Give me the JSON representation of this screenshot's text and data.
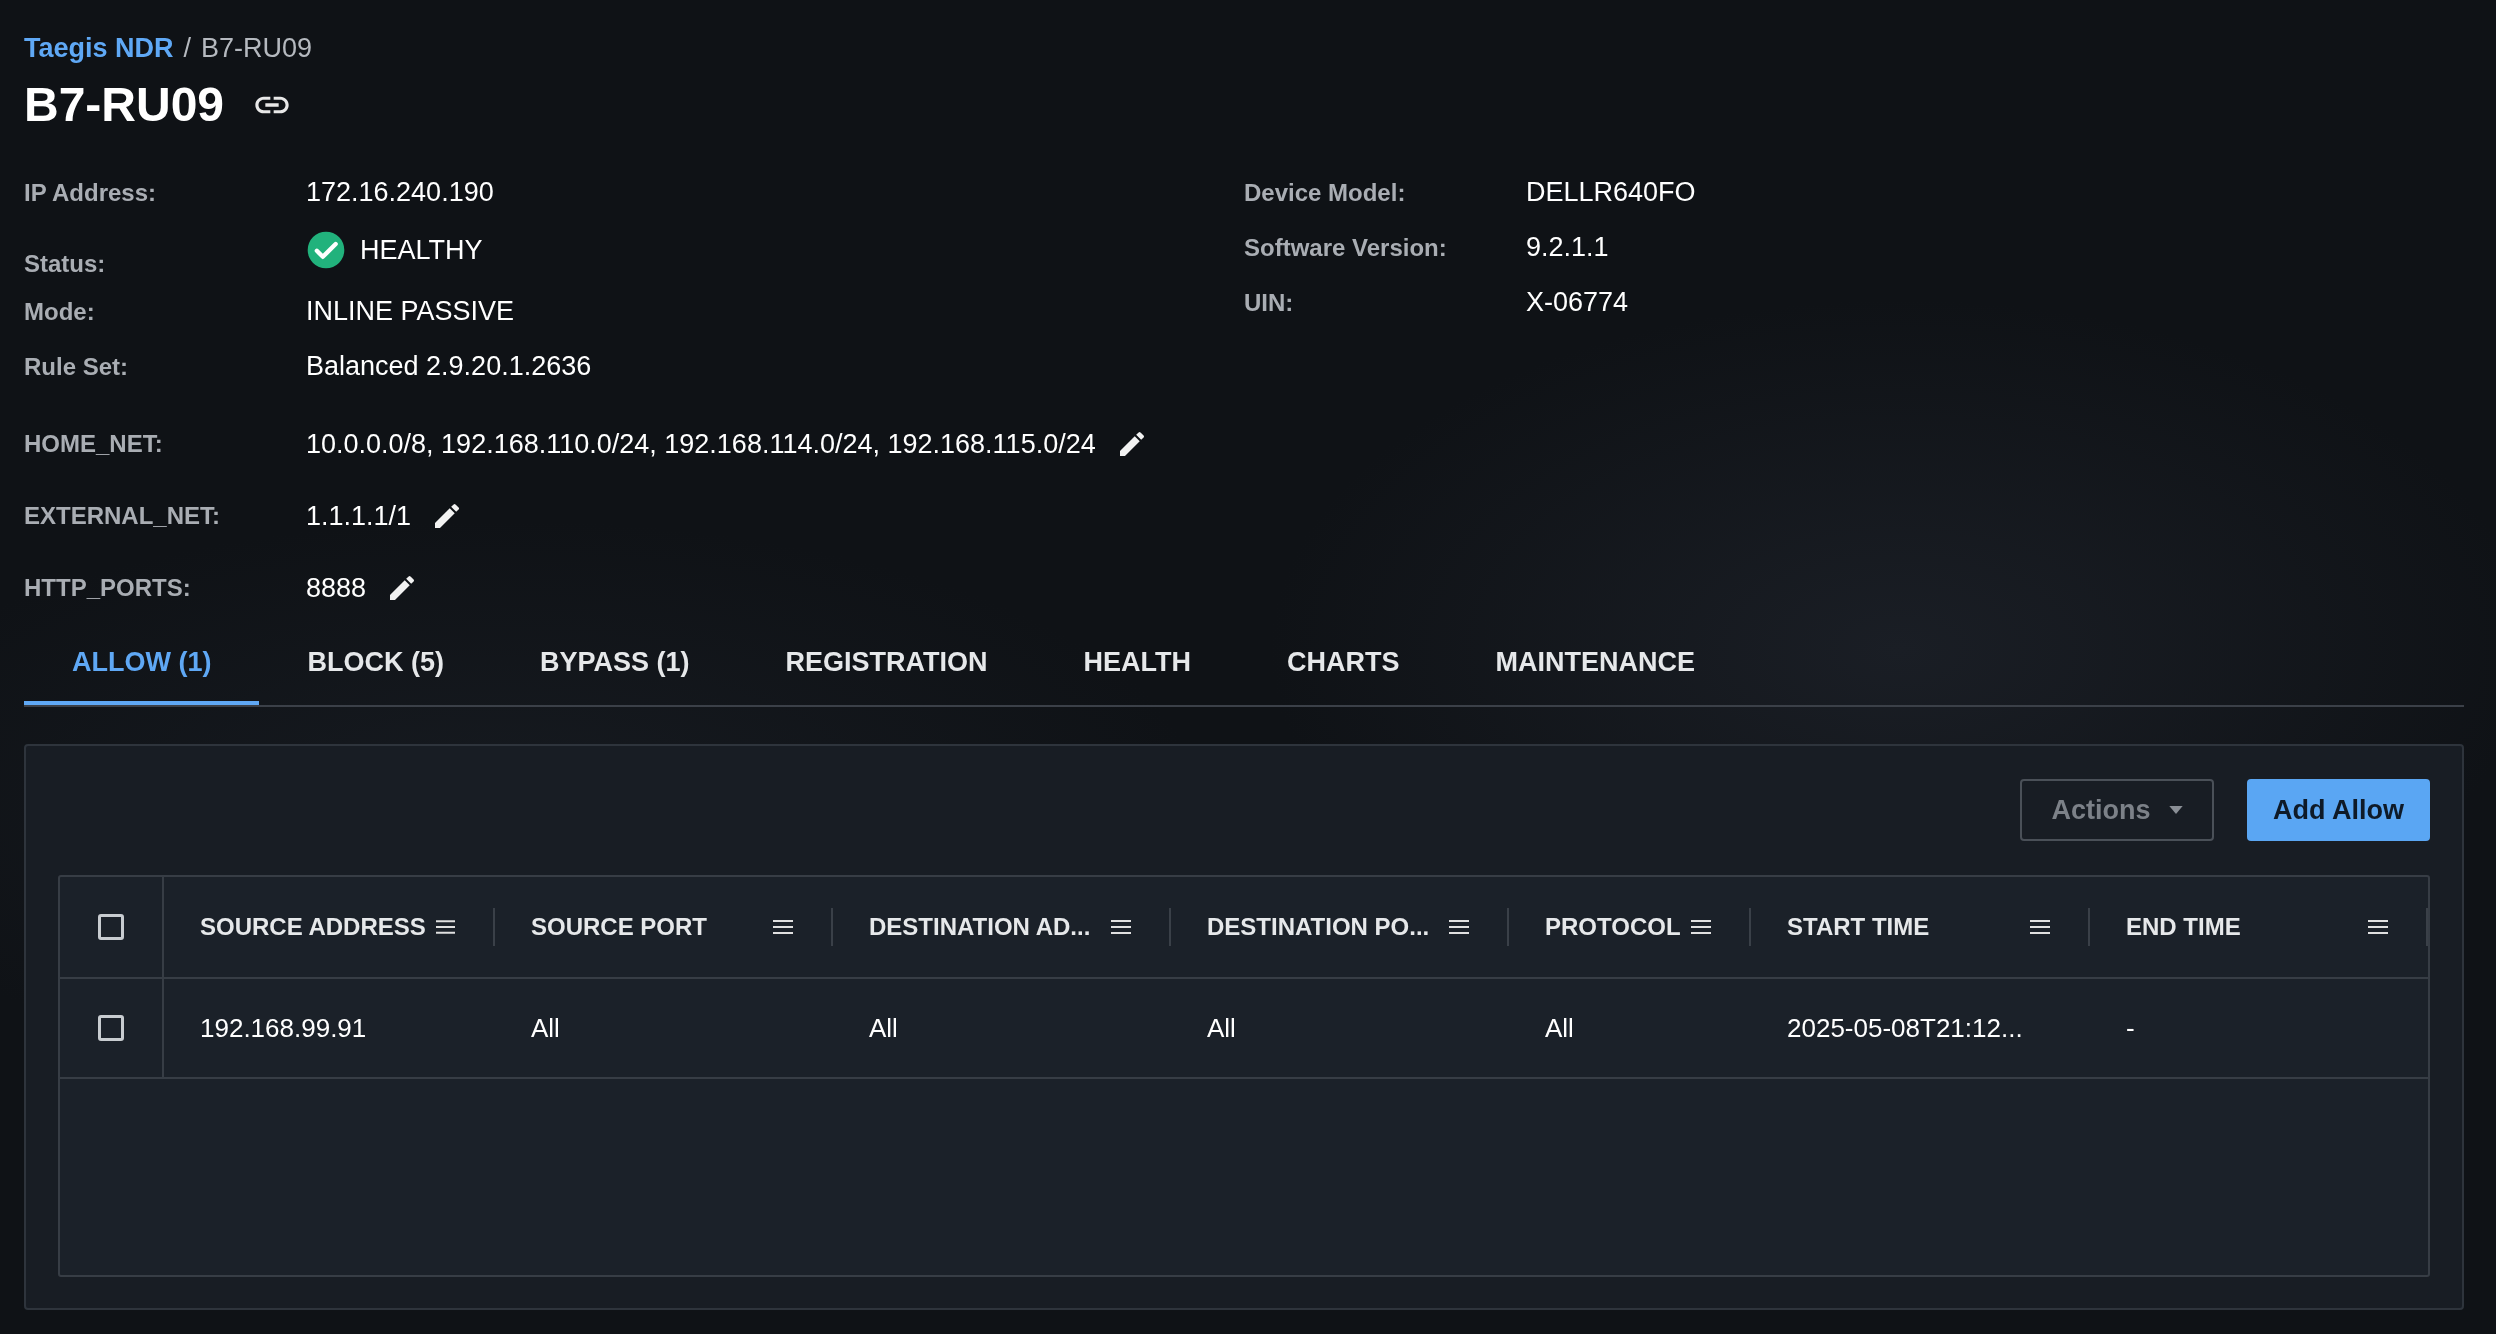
{
  "breadcrumb": {
    "separator": "/",
    "items": [
      {
        "label": "Taegis NDR",
        "link": true
      },
      {
        "label": "B7-RU09",
        "link": false
      }
    ]
  },
  "title": "B7-RU09",
  "details_left": [
    {
      "label": "IP Address:",
      "value": "172.16.240.190",
      "kind": "text"
    },
    {
      "label": "Status:",
      "value": "HEALTHY",
      "kind": "status"
    },
    {
      "label": "Mode:",
      "value": "INLINE PASSIVE",
      "kind": "text"
    },
    {
      "label": "Rule Set:",
      "value": "Balanced 2.9.20.1.2636",
      "kind": "text"
    },
    {
      "label": "HOME_NET:",
      "value": "10.0.0.0/8, 192.168.110.0/24, 192.168.114.0/24, 192.168.115.0/24",
      "kind": "editable"
    },
    {
      "label": "EXTERNAL_NET:",
      "value": "1.1.1.1/1",
      "kind": "editable"
    },
    {
      "label": "HTTP_PORTS:",
      "value": "8888",
      "kind": "editable"
    }
  ],
  "details_right": [
    {
      "label": "Device Model:",
      "value": "DELLR640FO",
      "kind": "text"
    },
    {
      "label": "Software Version:",
      "value": "9.2.1.1",
      "kind": "text"
    },
    {
      "label": "UIN:",
      "value": "X-06774",
      "kind": "text"
    }
  ],
  "tabs": [
    {
      "label": "ALLOW (1)",
      "selected": true
    },
    {
      "label": "BLOCK (5)",
      "selected": false
    },
    {
      "label": "BYPASS (1)",
      "selected": false
    },
    {
      "label": "REGISTRATION",
      "selected": false
    },
    {
      "label": "HEALTH",
      "selected": false
    },
    {
      "label": "CHARTS",
      "selected": false
    },
    {
      "label": "MAINTENANCE",
      "selected": false
    }
  ],
  "actions_button": {
    "label": "Actions",
    "disabled": true
  },
  "add_button": {
    "label": "Add Allow"
  },
  "table": {
    "header_checked": false,
    "columns": [
      "SOURCE ADDRESS",
      "SOURCE PORT",
      "DESTINATION AD...",
      "DESTINATION PO...",
      "PROTOCOL",
      "START TIME",
      "END TIME"
    ],
    "rows": [
      {
        "checked": false,
        "cells": [
          "192.168.99.91",
          "All",
          "All",
          "All",
          "All",
          "2025-05-08T21:12...",
          "-"
        ]
      }
    ]
  }
}
